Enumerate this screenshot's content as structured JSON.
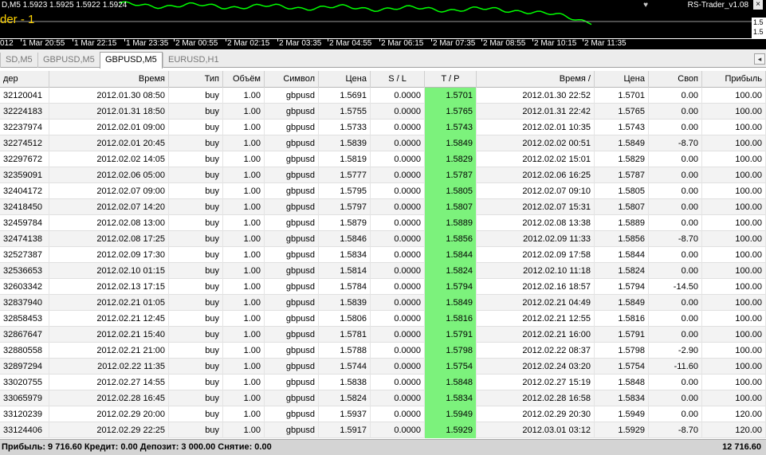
{
  "chart": {
    "header": "D,M5  1.5923 1.5925 1.5922 1.5924",
    "brand": "der - 1",
    "indicator": "RS-Trader_v1.08",
    "close_glyph": "×",
    "heart_glyph": "♥",
    "price_scale": [
      "1.5",
      "1.5"
    ],
    "line_color": "#00ff00"
  },
  "time_axis": [
    "012",
    "1 Mar 20:55",
    "1 Mar 22:15",
    "1 Mar 23:35",
    "2 Mar 00:55",
    "2 Mar 02:15",
    "2 Mar 03:35",
    "2 Mar 04:55",
    "2 Mar 06:15",
    "2 Mar 07:35",
    "2 Mar 08:55",
    "2 Mar 10:15",
    "2 Mar 11:35"
  ],
  "tabs": [
    "SD,M5",
    "GBPUSD,M5",
    "GBPUSD,M5",
    "EURUSD,H1"
  ],
  "active_tab": 2,
  "tab_scroll_glyph": "◂",
  "columns": [
    "дер",
    "Время",
    "Тип",
    "Объём",
    "Символ",
    "Цена",
    "S / L",
    "T / P",
    "Время   /",
    "Цена",
    "Своп",
    "Прибыль"
  ],
  "rows": [
    [
      "32120041",
      "2012.01.30 08:50",
      "buy",
      "1.00",
      "gbpusd",
      "1.5691",
      "0.0000",
      "1.5701",
      "2012.01.30 22:52",
      "1.5701",
      "0.00",
      "100.00"
    ],
    [
      "32224183",
      "2012.01.31 18:50",
      "buy",
      "1.00",
      "gbpusd",
      "1.5755",
      "0.0000",
      "1.5765",
      "2012.01.31 22:42",
      "1.5765",
      "0.00",
      "100.00"
    ],
    [
      "32237974",
      "2012.02.01 09:00",
      "buy",
      "1.00",
      "gbpusd",
      "1.5733",
      "0.0000",
      "1.5743",
      "2012.02.01 10:35",
      "1.5743",
      "0.00",
      "100.00"
    ],
    [
      "32274512",
      "2012.02.01 20:45",
      "buy",
      "1.00",
      "gbpusd",
      "1.5839",
      "0.0000",
      "1.5849",
      "2012.02.02 00:51",
      "1.5849",
      "-8.70",
      "100.00"
    ],
    [
      "32297672",
      "2012.02.02 14:05",
      "buy",
      "1.00",
      "gbpusd",
      "1.5819",
      "0.0000",
      "1.5829",
      "2012.02.02 15:01",
      "1.5829",
      "0.00",
      "100.00"
    ],
    [
      "32359091",
      "2012.02.06 05:00",
      "buy",
      "1.00",
      "gbpusd",
      "1.5777",
      "0.0000",
      "1.5787",
      "2012.02.06 16:25",
      "1.5787",
      "0.00",
      "100.00"
    ],
    [
      "32404172",
      "2012.02.07 09:00",
      "buy",
      "1.00",
      "gbpusd",
      "1.5795",
      "0.0000",
      "1.5805",
      "2012.02.07 09:10",
      "1.5805",
      "0.00",
      "100.00"
    ],
    [
      "32418450",
      "2012.02.07 14:20",
      "buy",
      "1.00",
      "gbpusd",
      "1.5797",
      "0.0000",
      "1.5807",
      "2012.02.07 15:31",
      "1.5807",
      "0.00",
      "100.00"
    ],
    [
      "32459784",
      "2012.02.08 13:00",
      "buy",
      "1.00",
      "gbpusd",
      "1.5879",
      "0.0000",
      "1.5889",
      "2012.02.08 13:38",
      "1.5889",
      "0.00",
      "100.00"
    ],
    [
      "32474138",
      "2012.02.08 17:25",
      "buy",
      "1.00",
      "gbpusd",
      "1.5846",
      "0.0000",
      "1.5856",
      "2012.02.09 11:33",
      "1.5856",
      "-8.70",
      "100.00"
    ],
    [
      "32527387",
      "2012.02.09 17:30",
      "buy",
      "1.00",
      "gbpusd",
      "1.5834",
      "0.0000",
      "1.5844",
      "2012.02.09 17:58",
      "1.5844",
      "0.00",
      "100.00"
    ],
    [
      "32536653",
      "2012.02.10 01:15",
      "buy",
      "1.00",
      "gbpusd",
      "1.5814",
      "0.0000",
      "1.5824",
      "2012.02.10 11:18",
      "1.5824",
      "0.00",
      "100.00"
    ],
    [
      "32603342",
      "2012.02.13 17:15",
      "buy",
      "1.00",
      "gbpusd",
      "1.5784",
      "0.0000",
      "1.5794",
      "2012.02.16 18:57",
      "1.5794",
      "-14.50",
      "100.00"
    ],
    [
      "32837940",
      "2012.02.21 01:05",
      "buy",
      "1.00",
      "gbpusd",
      "1.5839",
      "0.0000",
      "1.5849",
      "2012.02.21 04:49",
      "1.5849",
      "0.00",
      "100.00"
    ],
    [
      "32858453",
      "2012.02.21 12:45",
      "buy",
      "1.00",
      "gbpusd",
      "1.5806",
      "0.0000",
      "1.5816",
      "2012.02.21 12:55",
      "1.5816",
      "0.00",
      "100.00"
    ],
    [
      "32867647",
      "2012.02.21 15:40",
      "buy",
      "1.00",
      "gbpusd",
      "1.5781",
      "0.0000",
      "1.5791",
      "2012.02.21 16:00",
      "1.5791",
      "0.00",
      "100.00"
    ],
    [
      "32880558",
      "2012.02.21 21:00",
      "buy",
      "1.00",
      "gbpusd",
      "1.5788",
      "0.0000",
      "1.5798",
      "2012.02.22 08:37",
      "1.5798",
      "-2.90",
      "100.00"
    ],
    [
      "32897294",
      "2012.02.22 11:35",
      "buy",
      "1.00",
      "gbpusd",
      "1.5744",
      "0.0000",
      "1.5754",
      "2012.02.24 03:20",
      "1.5754",
      "-11.60",
      "100.00"
    ],
    [
      "33020755",
      "2012.02.27 14:55",
      "buy",
      "1.00",
      "gbpusd",
      "1.5838",
      "0.0000",
      "1.5848",
      "2012.02.27 15:19",
      "1.5848",
      "0.00",
      "100.00"
    ],
    [
      "33065979",
      "2012.02.28 16:45",
      "buy",
      "1.00",
      "gbpusd",
      "1.5824",
      "0.0000",
      "1.5834",
      "2012.02.28 16:58",
      "1.5834",
      "0.00",
      "100.00"
    ],
    [
      "33120239",
      "2012.02.29 20:00",
      "buy",
      "1.00",
      "gbpusd",
      "1.5937",
      "0.0000",
      "1.5949",
      "2012.02.29 20:30",
      "1.5949",
      "0.00",
      "120.00"
    ],
    [
      "33124406",
      "2012.02.29 22:25",
      "buy",
      "1.00",
      "gbpusd",
      "1.5917",
      "0.0000",
      "1.5929",
      "2012.03.01 03:12",
      "1.5929",
      "-8.70",
      "120.00"
    ]
  ],
  "tp_highlight_color": "#7cf27c",
  "footer": {
    "summary": "Прибыль: 9 716.60  Кредит: 0.00  Депозит: 3 000.00  Снятие: 0.00",
    "total": "12 716.60"
  }
}
